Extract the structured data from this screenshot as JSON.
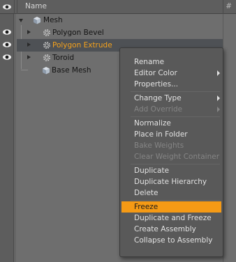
{
  "header": {
    "name_label": "Name",
    "hash_label": "#"
  },
  "tree": {
    "root": {
      "label": "Mesh",
      "icon": "mesh-cube-icon"
    },
    "items": [
      {
        "label": "Polygon Bevel",
        "icon": "gear-icon",
        "visible": true
      },
      {
        "label": "Polygon Extrude",
        "icon": "gear-icon",
        "visible": true,
        "selected": true
      },
      {
        "label": "Toroid",
        "icon": "gear-icon",
        "visible": true
      },
      {
        "label": "Base Mesh",
        "icon": "mesh-cube-icon",
        "visible": false
      }
    ]
  },
  "menu": {
    "items": [
      {
        "label": "Rename"
      },
      {
        "label": "Editor Color",
        "submenu": true
      },
      {
        "label": "Properties..."
      },
      {
        "label": "Change Type",
        "submenu": true
      },
      {
        "label": "Add Override",
        "submenu": true,
        "disabled": true
      },
      {
        "label": "Normalize"
      },
      {
        "label": "Place in Folder"
      },
      {
        "label": "Bake Weights",
        "disabled": true
      },
      {
        "label": "Clear Weight Container",
        "disabled": true
      },
      {
        "label": "Duplicate"
      },
      {
        "label": "Duplicate Hierarchy"
      },
      {
        "label": "Delete"
      },
      {
        "label": "Freeze",
        "highlighted": true
      },
      {
        "label": "Duplicate and Freeze"
      },
      {
        "label": "Create Assembly"
      },
      {
        "label": "Collapse to Assembly"
      }
    ]
  },
  "colors": {
    "highlight": "#f59a15",
    "selected_text": "#f5a21c"
  }
}
